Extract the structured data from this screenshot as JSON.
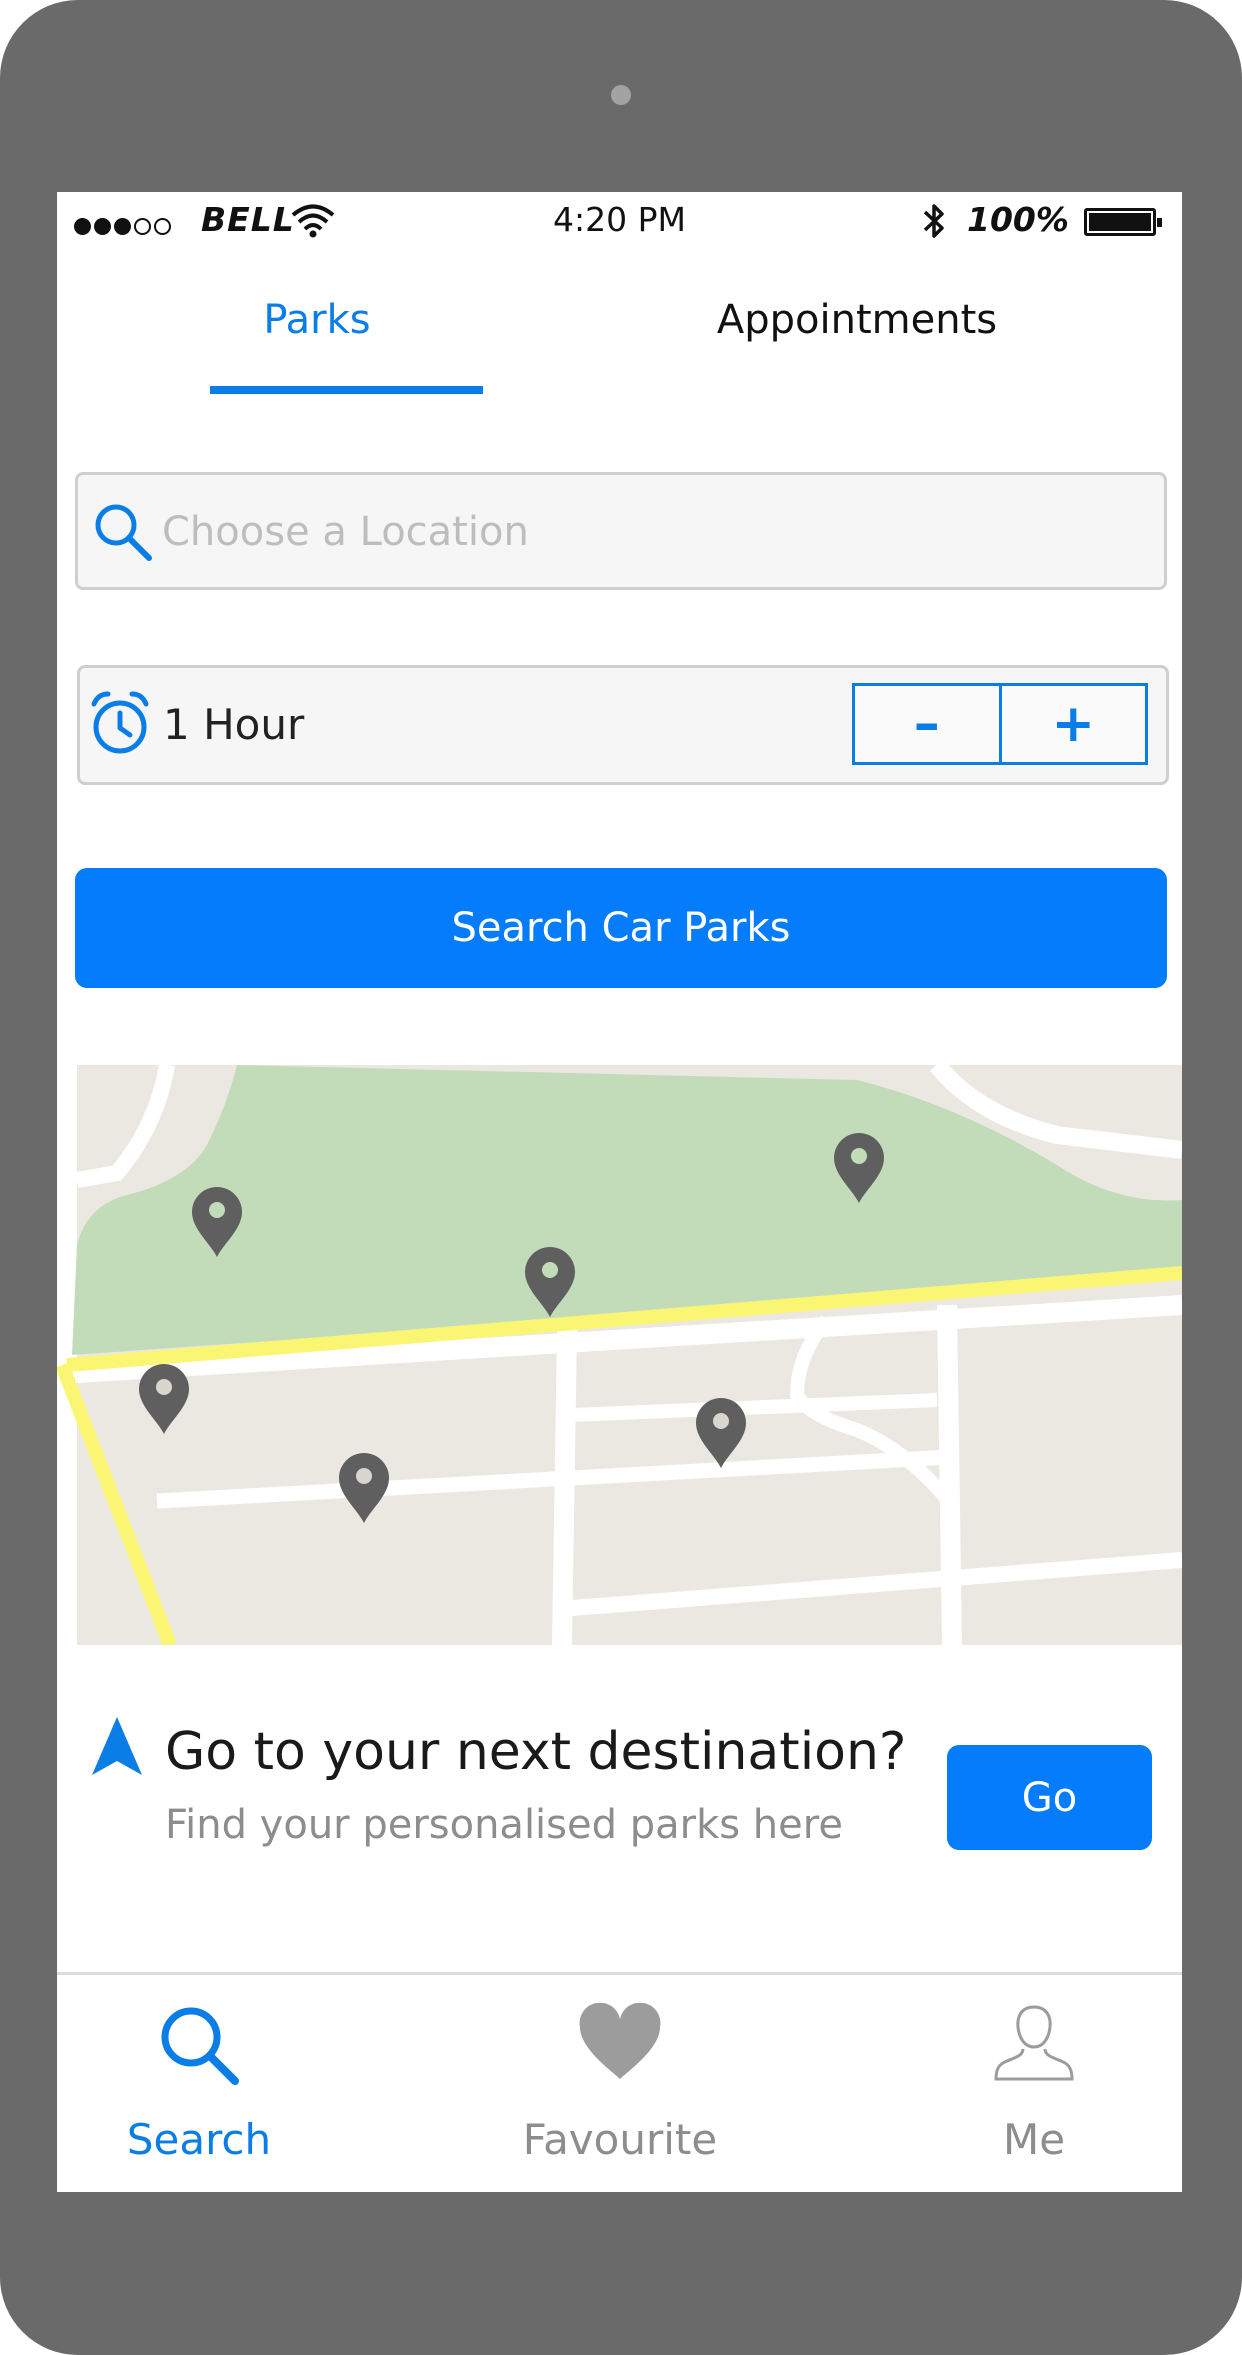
{
  "status_bar": {
    "carrier": "BELL",
    "time": "4:20 PM",
    "battery": "100%",
    "signal_icon": "signal-dots-icon",
    "wifi_icon": "wifi-icon",
    "bluetooth_icon": "bluetooth-icon"
  },
  "tabs": [
    {
      "label": "Parks",
      "active": true
    },
    {
      "label": "Appointments",
      "active": false
    }
  ],
  "location": {
    "placeholder": "Choose a Location",
    "value": ""
  },
  "duration": {
    "value": "1 Hour",
    "decrement_label": "–",
    "increment_label": "+"
  },
  "search_button": {
    "label": "Search Car Parks"
  },
  "map": {
    "pin_count": 6
  },
  "destination": {
    "title": "Go to your next destination?",
    "subtitle": "Find your personalised parks here",
    "go_label": "Go"
  },
  "bottom_nav": [
    {
      "label": "Search",
      "icon": "search-icon",
      "active": true
    },
    {
      "label": "Favourite",
      "icon": "heart-icon",
      "active": false
    },
    {
      "label": "Me",
      "icon": "user-icon",
      "active": false
    }
  ],
  "colors": {
    "accent": "#057cfb",
    "phone_frame": "#6a6a6a",
    "map_park": "#c2dcb9",
    "map_land": "#ebe8e2",
    "map_main_road": "#fbf574",
    "pin": "#5f5f5f"
  }
}
